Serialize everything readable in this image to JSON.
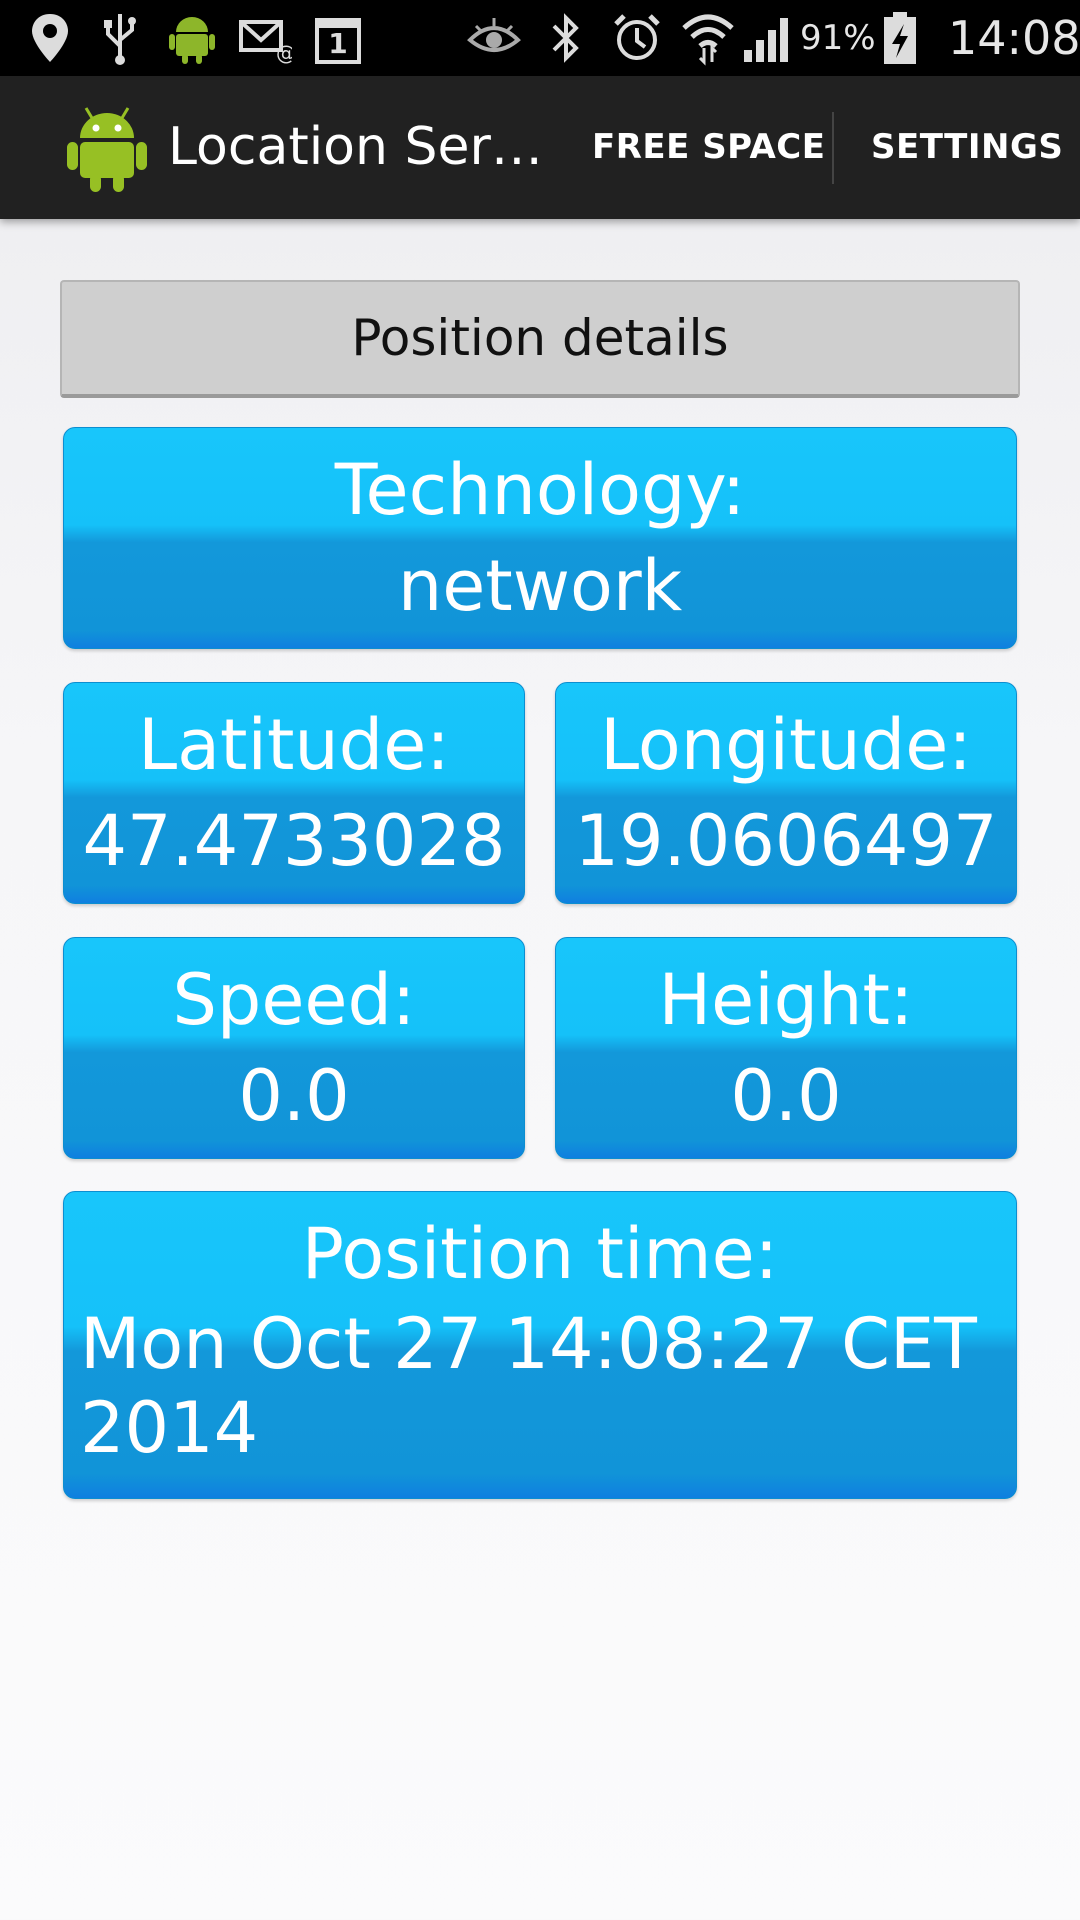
{
  "status_bar": {
    "battery": "91%",
    "time": "14:08",
    "calendar_day": "1",
    "icons": [
      "location-pin-icon",
      "usb-icon",
      "android-icon",
      "email-icon",
      "calendar-icon",
      "eye-icon",
      "bluetooth-icon",
      "alarm-icon",
      "wifi-icon",
      "signal-icon",
      "battery-charging-icon"
    ]
  },
  "action_bar": {
    "title": "Location Ser…",
    "free_space_label": "FREE SPACE",
    "settings_label": "SETTINGS"
  },
  "header": {
    "label": "Position details"
  },
  "tiles": {
    "technology": {
      "label": "Technology:",
      "value": "network"
    },
    "latitude": {
      "label": "Latitude:",
      "value": "47.4733028"
    },
    "longitude": {
      "label": "Longitude:",
      "value": "19.0606497"
    },
    "speed": {
      "label": "Speed:",
      "value": "0.0"
    },
    "height": {
      "label": "Height:",
      "value": "0.0"
    },
    "position_time": {
      "label": "Position time:",
      "value": "Mon Oct 27 14:08:27 CET 2014"
    }
  },
  "colors": {
    "tile_top": "#18c6fb",
    "tile_bottom": "#1194d8",
    "action_bar": "#212121",
    "header_button": "#cfcfcf",
    "android_green": "#97c024"
  }
}
